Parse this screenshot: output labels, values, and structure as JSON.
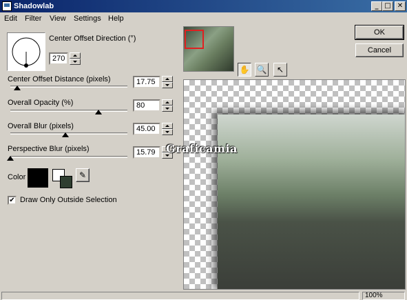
{
  "window": {
    "title": "Shadowlab",
    "minimize": "_",
    "maximize": "□",
    "close": "✕"
  },
  "menu": [
    "Edit",
    "Filter",
    "View",
    "Settings",
    "Help"
  ],
  "direction": {
    "label": "Center Offset Direction (°)",
    "value": "270"
  },
  "sliders": [
    {
      "label": "Center Offset Distance (pixels)",
      "value": "17.75",
      "level": 0.06
    },
    {
      "label": "Overall Opacity (%)",
      "value": "80",
      "level": 0.8
    },
    {
      "label": "Overall Blur (pixels)",
      "value": "45.00",
      "level": 0.5
    },
    {
      "label": "Perspective Blur (pixels)",
      "value": "15.79",
      "level": 0.0
    }
  ],
  "color": {
    "label": "Color",
    "primary": "#000000",
    "secondary": "#ffffff",
    "tertiary": "#2f3e30"
  },
  "checkbox": {
    "label": "Draw Only Outside Selection",
    "checked": true,
    "mark": "✔"
  },
  "buttons": {
    "ok": "OK",
    "cancel": "Cancel"
  },
  "tools": {
    "hand": "✋",
    "zoom": "🔍",
    "arrow": "↖"
  },
  "watermark": "Graficamia",
  "status": {
    "zoom": "100%"
  }
}
